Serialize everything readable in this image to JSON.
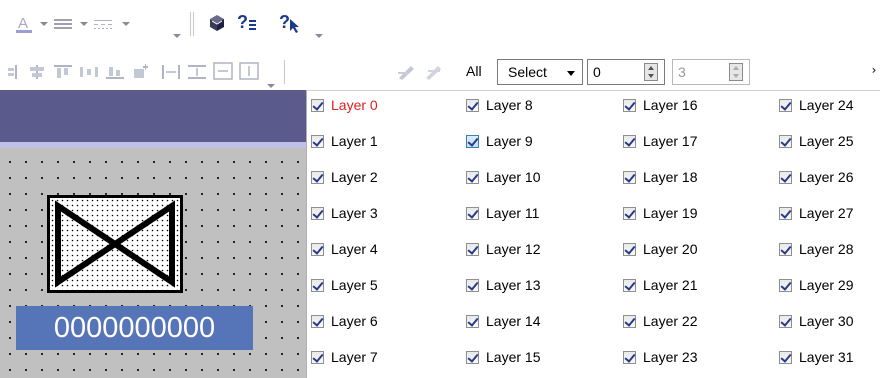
{
  "toolbar_top": {
    "icons": [
      "font-color-icon",
      "line-style-icon",
      "line-dash-icon",
      "book-icon",
      "help-index-icon",
      "whats-this-icon"
    ]
  },
  "toolbar_layer": {
    "all_label": "All",
    "select_value": "Select",
    "spin1_value": "0",
    "spin2_value": "3",
    "spin2_enabled": false
  },
  "canvas": {
    "display_value": "0000000000"
  },
  "layers": [
    {
      "label": "Layer 0",
      "checked": true,
      "highlight": false,
      "red": true
    },
    {
      "label": "Layer 1",
      "checked": true,
      "highlight": false,
      "red": false
    },
    {
      "label": "Layer 2",
      "checked": true,
      "highlight": false,
      "red": false
    },
    {
      "label": "Layer 3",
      "checked": true,
      "highlight": false,
      "red": false
    },
    {
      "label": "Layer 4",
      "checked": true,
      "highlight": false,
      "red": false
    },
    {
      "label": "Layer 5",
      "checked": true,
      "highlight": false,
      "red": false
    },
    {
      "label": "Layer 6",
      "checked": true,
      "highlight": false,
      "red": false
    },
    {
      "label": "Layer 7",
      "checked": true,
      "highlight": false,
      "red": false
    },
    {
      "label": "Layer 8",
      "checked": true,
      "highlight": false,
      "red": false
    },
    {
      "label": "Layer 9",
      "checked": true,
      "highlight": true,
      "red": false
    },
    {
      "label": "Layer 10",
      "checked": true,
      "highlight": false,
      "red": false
    },
    {
      "label": "Layer 11",
      "checked": true,
      "highlight": false,
      "red": false
    },
    {
      "label": "Layer 12",
      "checked": true,
      "highlight": false,
      "red": false
    },
    {
      "label": "Layer 13",
      "checked": true,
      "highlight": false,
      "red": false
    },
    {
      "label": "Layer 14",
      "checked": true,
      "highlight": false,
      "red": false
    },
    {
      "label": "Layer 15",
      "checked": true,
      "highlight": false,
      "red": false
    },
    {
      "label": "Layer 16",
      "checked": true,
      "highlight": false,
      "red": false
    },
    {
      "label": "Layer 17",
      "checked": true,
      "highlight": false,
      "red": false
    },
    {
      "label": "Layer 18",
      "checked": true,
      "highlight": false,
      "red": false
    },
    {
      "label": "Layer 19",
      "checked": true,
      "highlight": false,
      "red": false
    },
    {
      "label": "Layer 20",
      "checked": true,
      "highlight": false,
      "red": false
    },
    {
      "label": "Layer 21",
      "checked": true,
      "highlight": false,
      "red": false
    },
    {
      "label": "Layer 22",
      "checked": true,
      "highlight": false,
      "red": false
    },
    {
      "label": "Layer 23",
      "checked": true,
      "highlight": false,
      "red": false
    },
    {
      "label": "Layer 24",
      "checked": true,
      "highlight": false,
      "red": false
    },
    {
      "label": "Layer 25",
      "checked": true,
      "highlight": false,
      "red": false
    },
    {
      "label": "Layer 26",
      "checked": true,
      "highlight": false,
      "red": false
    },
    {
      "label": "Layer 27",
      "checked": true,
      "highlight": false,
      "red": false
    },
    {
      "label": "Layer 28",
      "checked": true,
      "highlight": false,
      "red": false
    },
    {
      "label": "Layer 29",
      "checked": true,
      "highlight": false,
      "red": false
    },
    {
      "label": "Layer 30",
      "checked": true,
      "highlight": false,
      "red": false
    },
    {
      "label": "Layer 31",
      "checked": true,
      "highlight": false,
      "red": false
    }
  ],
  "colors": {
    "banner": "#5a5a8c",
    "display_box": "#5575b8",
    "layer0_text": "#e02020",
    "canvas_bg": "#c0c0c0"
  }
}
